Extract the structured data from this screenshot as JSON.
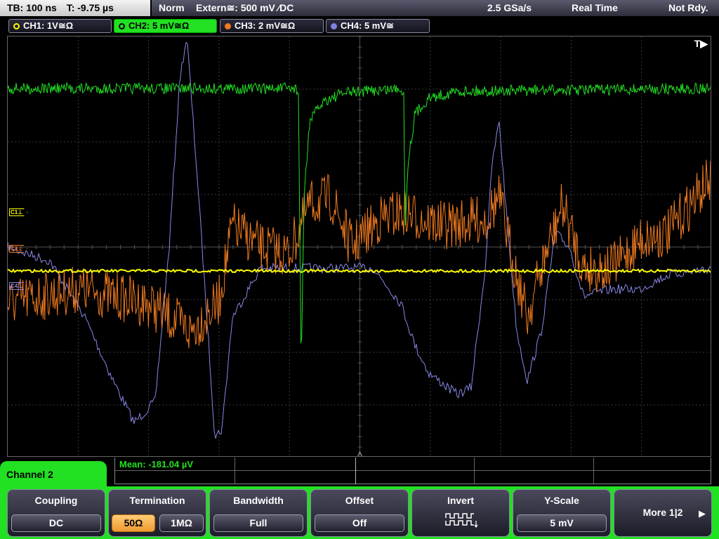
{
  "top": {
    "timebase": "TB: 100 ns",
    "trigger_time": "T: -9.75 µs",
    "trigger_mode": "Norm",
    "trigger_source": "Extern≅: 500 mV ⁄DC",
    "sample_rate": "2.5 GSa/s",
    "acq_mode": "Real Time",
    "ready_state": "Not Rdy."
  },
  "channels": [
    {
      "label": "CH1: 1V≅Ω",
      "color": "#ffff00",
      "active": false
    },
    {
      "label": "CH2: 5 mV≅Ω",
      "color": "#22e022",
      "active": true
    },
    {
      "label": "CH3: 2 mV≅Ω",
      "color": "#f07a20",
      "active": false
    },
    {
      "label": "CH4: 5 mV≅",
      "color": "#8080e0",
      "active": false
    }
  ],
  "grid": {
    "trigger_badge": "T▶",
    "markers": [
      {
        "text": "C1⊥",
        "color": "#ffff00"
      },
      {
        "text": "C3⊥",
        "color": "#f07a20"
      },
      {
        "text": "C4⊥",
        "color": "#8080e0"
      }
    ]
  },
  "measurement": {
    "label": "Mean: -181.04 µV"
  },
  "menu": {
    "title": "Channel 2",
    "coupling": {
      "title": "Coupling",
      "value": "DC"
    },
    "termination": {
      "title": "Termination",
      "option_a": "50Ω",
      "option_b": "1MΩ"
    },
    "bandwidth": {
      "title": "Bandwidth",
      "value": "Full"
    },
    "offset": {
      "title": "Offset",
      "value": "Off"
    },
    "invert": {
      "title": "Invert",
      "icon": "inverted-square-wave-icon"
    },
    "yscale": {
      "title": "Y-Scale",
      "value": "5 mV"
    },
    "more": {
      "label": "More 1|2",
      "icon": "triangle-right-icon"
    }
  }
}
